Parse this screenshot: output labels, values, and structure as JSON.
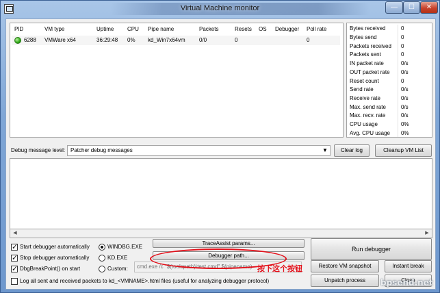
{
  "window": {
    "title": "Virtual Machine monitor",
    "min_glyph": "—",
    "max_glyph": "☐",
    "close_glyph": "✕"
  },
  "vm_table": {
    "columns": [
      "PID",
      "VM type",
      "Uptime",
      "CPU",
      "Pipe name",
      "Packets",
      "Resets",
      "OS",
      "Debugger",
      "Poll rate"
    ],
    "rows": [
      {
        "pid": "6288",
        "vm_type": "VMWare x64",
        "uptime": "36:29:48",
        "cpu": "0%",
        "pipe_name": "kd_Win7x64vm",
        "packets": "0/0",
        "resets": "0",
        "os": "",
        "debugger": "",
        "poll_rate": "0",
        "status_color": "#2da814"
      }
    ]
  },
  "stats": [
    {
      "label": "Bytes received",
      "value": "0"
    },
    {
      "label": "Bytes send",
      "value": "0"
    },
    {
      "label": "Packets received",
      "value": "0"
    },
    {
      "label": "Packets sent",
      "value": "0"
    },
    {
      "label": "IN packet rate",
      "value": "0/s"
    },
    {
      "label": "OUT packet rate",
      "value": "0/s"
    },
    {
      "label": "Reset count",
      "value": "0"
    },
    {
      "label": "Send rate",
      "value": "0/s"
    },
    {
      "label": "Receive rate",
      "value": "0/s"
    },
    {
      "label": "Max. send rate",
      "value": "0/s"
    },
    {
      "label": "Max. recv. rate",
      "value": "0/s"
    },
    {
      "label": "CPU usage",
      "value": "0%"
    },
    {
      "label": "Avg. CPU usage",
      "value": "0%"
    }
  ],
  "debug": {
    "level_label": "Debug message level:",
    "level_selected": "Patcher debug messages",
    "clear_log": "Clear log",
    "cleanup_vm_list": "Cleanup VM List"
  },
  "options": {
    "start_debugger_auto": {
      "label": "Start debugger automatically",
      "checked": true
    },
    "stop_debugger_auto": {
      "label": "Stop debugger automatically",
      "checked": true
    },
    "dbg_break_point": {
      "label": "DbgBreakPoint() on start",
      "checked": true
    },
    "debugger_windbg": {
      "label": "WINDBG.EXE",
      "selected": true
    },
    "debugger_kd": {
      "label": "KD.EXE",
      "selected": false
    },
    "debugger_custom": {
      "label": "Custom:",
      "selected": false
    },
    "custom_command": "cmd.exe /c \"$(toolspath)\\test.cmd\" $(pipename)",
    "log_packets": {
      "label": "Log all sent and received packets to kd_<VMNAME>.html files (useful for analyzing debugger protocol)",
      "checked": false
    }
  },
  "buttons": {
    "trace_assist": "TraceAssist params...",
    "debugger_path": "Debugger path...",
    "run_debugger": "Run debugger",
    "restore_snapshot": "Restore VM snapshot",
    "instant_break": "Instant break",
    "unpatch_process": "Unpatch process",
    "close": "Close"
  },
  "annotation": {
    "text": "按下这个按钮",
    "color": "#e3101a"
  },
  "watermark": "bpsend.net"
}
